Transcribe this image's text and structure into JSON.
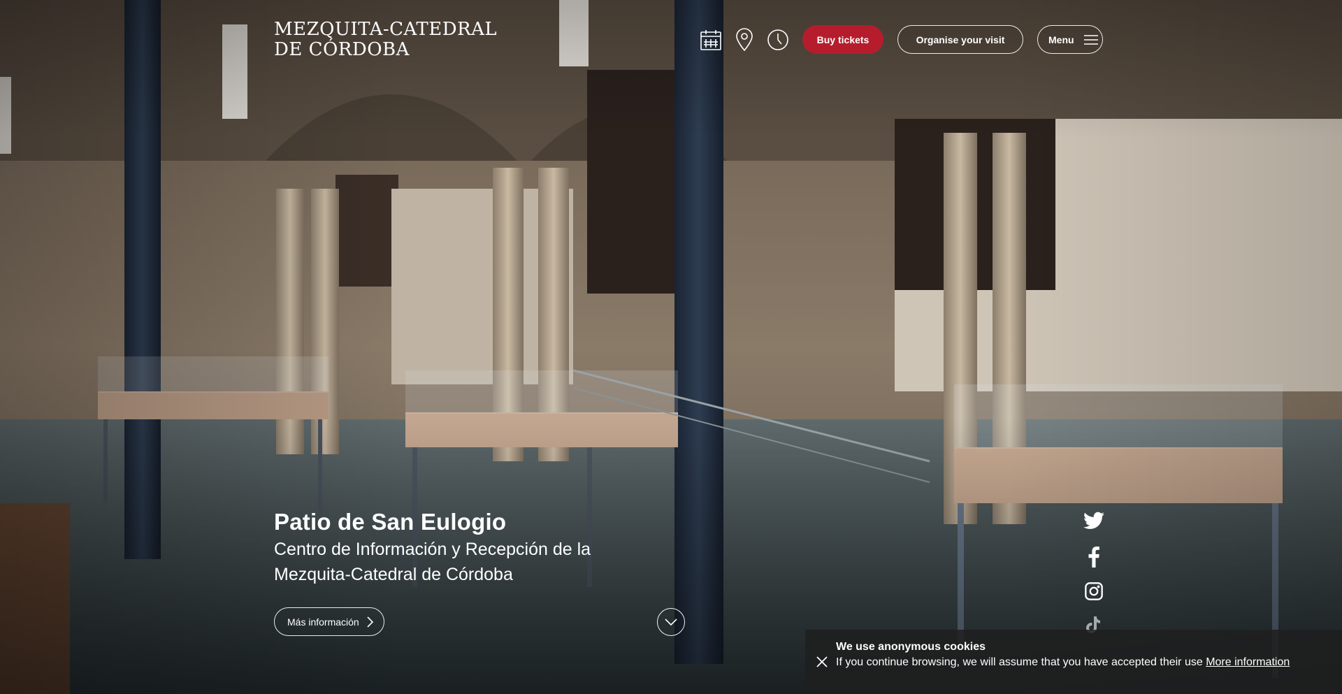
{
  "header": {
    "logo_line1": "MEZQUITA-CATEDRAL",
    "logo_line2": "DE CÓRDOBA",
    "icons": [
      "calendar-icon",
      "location-pin-icon",
      "clock-icon"
    ],
    "buy_tickets": "Buy tickets",
    "organise_visit": "Organise your visit",
    "menu": "Menu"
  },
  "hero": {
    "title": "Patio de San Eulogio",
    "subtitle": "Centro de Información y Recepción de la Mezquita-Catedral de Córdoba",
    "more_info": "Más información"
  },
  "social": [
    "twitter-icon",
    "facebook-icon",
    "instagram-icon",
    "tiktok-icon"
  ],
  "cookie": {
    "title": "We use anonymous cookies",
    "text": "If you continue browsing, we will assume that you have accepted their use",
    "link": "More information"
  },
  "colors": {
    "accent": "#b51d2d",
    "cookie_bg": "#1e1e1e"
  }
}
